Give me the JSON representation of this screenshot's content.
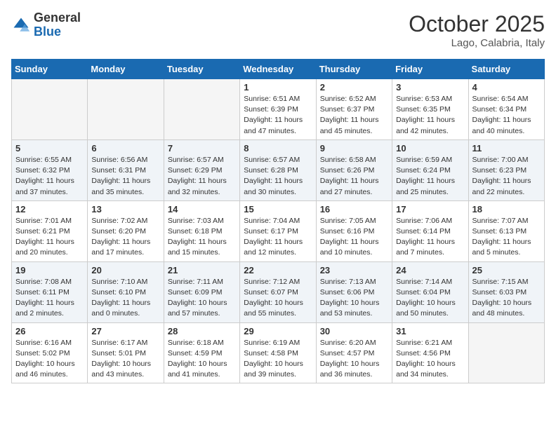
{
  "header": {
    "logo_general": "General",
    "logo_blue": "Blue",
    "month": "October 2025",
    "location": "Lago, Calabria, Italy"
  },
  "weekdays": [
    "Sunday",
    "Monday",
    "Tuesday",
    "Wednesday",
    "Thursday",
    "Friday",
    "Saturday"
  ],
  "weeks": [
    [
      {
        "day": "",
        "empty": true
      },
      {
        "day": "",
        "empty": true
      },
      {
        "day": "",
        "empty": true
      },
      {
        "day": "1",
        "sunrise": "6:51 AM",
        "sunset": "6:39 PM",
        "daylight": "11 hours and 47 minutes."
      },
      {
        "day": "2",
        "sunrise": "6:52 AM",
        "sunset": "6:37 PM",
        "daylight": "11 hours and 45 minutes."
      },
      {
        "day": "3",
        "sunrise": "6:53 AM",
        "sunset": "6:35 PM",
        "daylight": "11 hours and 42 minutes."
      },
      {
        "day": "4",
        "sunrise": "6:54 AM",
        "sunset": "6:34 PM",
        "daylight": "11 hours and 40 minutes."
      }
    ],
    [
      {
        "day": "5",
        "sunrise": "6:55 AM",
        "sunset": "6:32 PM",
        "daylight": "11 hours and 37 minutes."
      },
      {
        "day": "6",
        "sunrise": "6:56 AM",
        "sunset": "6:31 PM",
        "daylight": "11 hours and 35 minutes."
      },
      {
        "day": "7",
        "sunrise": "6:57 AM",
        "sunset": "6:29 PM",
        "daylight": "11 hours and 32 minutes."
      },
      {
        "day": "8",
        "sunrise": "6:57 AM",
        "sunset": "6:28 PM",
        "daylight": "11 hours and 30 minutes."
      },
      {
        "day": "9",
        "sunrise": "6:58 AM",
        "sunset": "6:26 PM",
        "daylight": "11 hours and 27 minutes."
      },
      {
        "day": "10",
        "sunrise": "6:59 AM",
        "sunset": "6:24 PM",
        "daylight": "11 hours and 25 minutes."
      },
      {
        "day": "11",
        "sunrise": "7:00 AM",
        "sunset": "6:23 PM",
        "daylight": "11 hours and 22 minutes."
      }
    ],
    [
      {
        "day": "12",
        "sunrise": "7:01 AM",
        "sunset": "6:21 PM",
        "daylight": "11 hours and 20 minutes."
      },
      {
        "day": "13",
        "sunrise": "7:02 AM",
        "sunset": "6:20 PM",
        "daylight": "11 hours and 17 minutes."
      },
      {
        "day": "14",
        "sunrise": "7:03 AM",
        "sunset": "6:18 PM",
        "daylight": "11 hours and 15 minutes."
      },
      {
        "day": "15",
        "sunrise": "7:04 AM",
        "sunset": "6:17 PM",
        "daylight": "11 hours and 12 minutes."
      },
      {
        "day": "16",
        "sunrise": "7:05 AM",
        "sunset": "6:16 PM",
        "daylight": "11 hours and 10 minutes."
      },
      {
        "day": "17",
        "sunrise": "7:06 AM",
        "sunset": "6:14 PM",
        "daylight": "11 hours and 7 minutes."
      },
      {
        "day": "18",
        "sunrise": "7:07 AM",
        "sunset": "6:13 PM",
        "daylight": "11 hours and 5 minutes."
      }
    ],
    [
      {
        "day": "19",
        "sunrise": "7:08 AM",
        "sunset": "6:11 PM",
        "daylight": "11 hours and 2 minutes."
      },
      {
        "day": "20",
        "sunrise": "7:10 AM",
        "sunset": "6:10 PM",
        "daylight": "11 hours and 0 minutes."
      },
      {
        "day": "21",
        "sunrise": "7:11 AM",
        "sunset": "6:09 PM",
        "daylight": "10 hours and 57 minutes."
      },
      {
        "day": "22",
        "sunrise": "7:12 AM",
        "sunset": "6:07 PM",
        "daylight": "10 hours and 55 minutes."
      },
      {
        "day": "23",
        "sunrise": "7:13 AM",
        "sunset": "6:06 PM",
        "daylight": "10 hours and 53 minutes."
      },
      {
        "day": "24",
        "sunrise": "7:14 AM",
        "sunset": "6:04 PM",
        "daylight": "10 hours and 50 minutes."
      },
      {
        "day": "25",
        "sunrise": "7:15 AM",
        "sunset": "6:03 PM",
        "daylight": "10 hours and 48 minutes."
      }
    ],
    [
      {
        "day": "26",
        "sunrise": "6:16 AM",
        "sunset": "5:02 PM",
        "daylight": "10 hours and 46 minutes."
      },
      {
        "day": "27",
        "sunrise": "6:17 AM",
        "sunset": "5:01 PM",
        "daylight": "10 hours and 43 minutes."
      },
      {
        "day": "28",
        "sunrise": "6:18 AM",
        "sunset": "4:59 PM",
        "daylight": "10 hours and 41 minutes."
      },
      {
        "day": "29",
        "sunrise": "6:19 AM",
        "sunset": "4:58 PM",
        "daylight": "10 hours and 39 minutes."
      },
      {
        "day": "30",
        "sunrise": "6:20 AM",
        "sunset": "4:57 PM",
        "daylight": "10 hours and 36 minutes."
      },
      {
        "day": "31",
        "sunrise": "6:21 AM",
        "sunset": "4:56 PM",
        "daylight": "10 hours and 34 minutes."
      },
      {
        "day": "",
        "empty": true
      }
    ]
  ]
}
